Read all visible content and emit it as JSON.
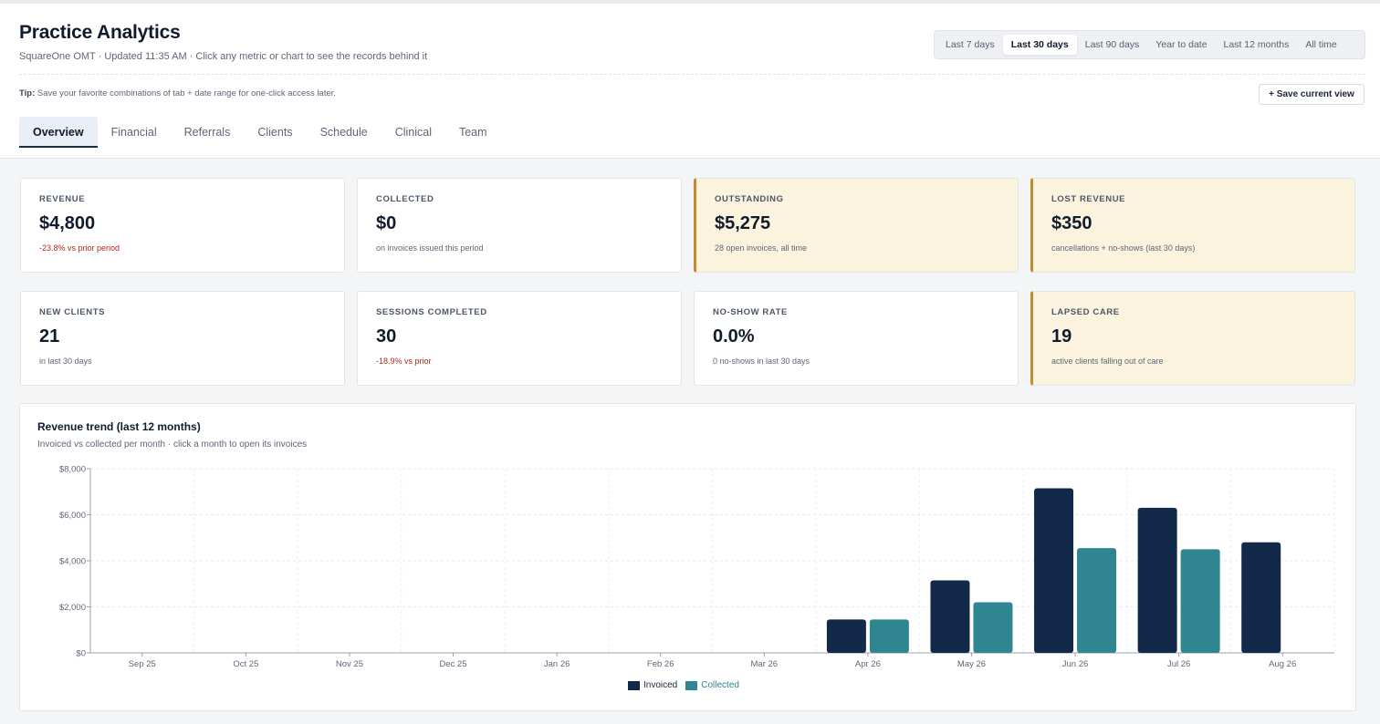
{
  "header": {
    "title": "Practice Analytics",
    "subtitle": "SquareOne OMT · Updated 11:35 AM · Click any metric or chart to see the records behind it",
    "tip_label": "Tip:",
    "tip_text": " Save your favorite combinations of tab + date range for one-click access later.",
    "save_view_label": "+ Save current view"
  },
  "date_ranges": [
    {
      "label": "Last 7 days",
      "active": false
    },
    {
      "label": "Last 30 days",
      "active": true
    },
    {
      "label": "Last 90 days",
      "active": false
    },
    {
      "label": "Year to date",
      "active": false
    },
    {
      "label": "Last 12 months",
      "active": false
    },
    {
      "label": "All time",
      "active": false
    }
  ],
  "tabs": [
    {
      "label": "Overview",
      "active": true
    },
    {
      "label": "Financial",
      "active": false
    },
    {
      "label": "Referrals",
      "active": false
    },
    {
      "label": "Clients",
      "active": false
    },
    {
      "label": "Schedule",
      "active": false
    },
    {
      "label": "Clinical",
      "active": false
    },
    {
      "label": "Team",
      "active": false
    }
  ],
  "metrics": [
    {
      "label": "REVENUE",
      "value": "$4,800",
      "note": "-23.8% vs prior period",
      "note_negative": true,
      "highlight": false
    },
    {
      "label": "COLLECTED",
      "value": "$0",
      "note": "on invoices issued this period",
      "note_negative": false,
      "highlight": false
    },
    {
      "label": "OUTSTANDING",
      "value": "$5,275",
      "note": "28 open invoices, all time",
      "note_negative": false,
      "highlight": true
    },
    {
      "label": "LOST REVENUE",
      "value": "$350",
      "note": "cancellations + no-shows (last 30 days)",
      "note_negative": false,
      "highlight": true
    },
    {
      "label": "NEW CLIENTS",
      "value": "21",
      "note": "in last 30 days",
      "note_negative": false,
      "highlight": false
    },
    {
      "label": "SESSIONS COMPLETED",
      "value": "30",
      "note": "-18.9% vs prior",
      "note_negative": true,
      "highlight": false
    },
    {
      "label": "NO-SHOW RATE",
      "value": "0.0%",
      "note": "0 no-shows in last 30 days",
      "note_negative": false,
      "highlight": false
    },
    {
      "label": "LAPSED CARE",
      "value": "19",
      "note": "active clients falling out of care",
      "note_negative": false,
      "highlight": true
    }
  ],
  "colors": {
    "invoiced": "#12294a",
    "collected": "#2f8690",
    "warning_accent": "#c48a2c",
    "negative": "#b3261e"
  },
  "chart_data": {
    "type": "bar",
    "title": "Revenue trend (last 12 months)",
    "subtitle": "Invoiced vs collected per month · click a month to open its invoices",
    "categories": [
      "Sep 25",
      "Oct 25",
      "Nov 25",
      "Dec 25",
      "Jan 26",
      "Feb 26",
      "Mar 26",
      "Apr 26",
      "May 26",
      "Jun 26",
      "Jul 26",
      "Aug 26"
    ],
    "series": [
      {
        "name": "Invoiced",
        "values": [
          0,
          0,
          0,
          0,
          0,
          0,
          0,
          1450,
          3150,
          7150,
          6300,
          4800
        ]
      },
      {
        "name": "Collected",
        "values": [
          0,
          0,
          0,
          0,
          0,
          0,
          0,
          1450,
          2200,
          4550,
          4500,
          0
        ]
      }
    ],
    "ylim": [
      0,
      8000
    ],
    "yticks": [
      "$0",
      "$2,000",
      "$4,000",
      "$6,000",
      "$8,000"
    ],
    "ytick_values": [
      0,
      2000,
      4000,
      6000,
      8000
    ],
    "grid": true,
    "legend": "bottom-center"
  }
}
